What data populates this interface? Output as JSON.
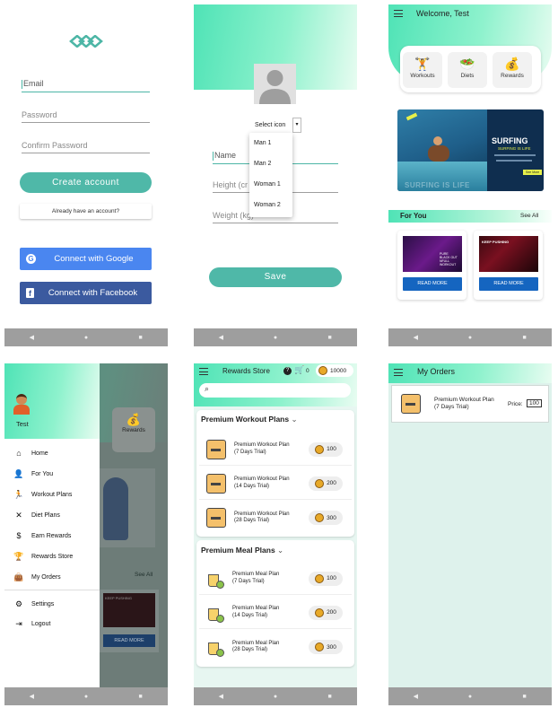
{
  "s1": {
    "email_placeholder": "Email",
    "password_placeholder": "Password",
    "confirm_placeholder": "Confirm Password",
    "create_btn": "Create account",
    "have_account_btn": "Already have an account?",
    "google_btn": "Connect with Google",
    "facebook_btn": "Connect with Facebook",
    "google_letter": "G",
    "facebook_letter": "f"
  },
  "s2": {
    "select_icon": "Select icon",
    "options": [
      "Man 1",
      "Man 2",
      "Woman 1",
      "Woman 2"
    ],
    "name_placeholder": "Name",
    "height_placeholder": "Height (cr",
    "weight_placeholder": "Weight (kg)",
    "save_btn": "Save"
  },
  "s3": {
    "welcome": "Welcome, Test",
    "categories": [
      "Workouts",
      "Diets",
      "Rewards"
    ],
    "banner_title": "SURFING",
    "banner_subtitle": "SURFING IS LIFE",
    "banner_bottom": "SURFING IS LIFE",
    "banner_cta": "See More",
    "for_you": "For You",
    "see_all": "See All",
    "card1_text": "PURE BLACK OUT NFULL WORKOUT",
    "card2_text": "KEEP PUSHING",
    "read_more": "READ MORE"
  },
  "s4": {
    "user_name": "Test",
    "bg_rewards": "Rewards",
    "bg_see_all": "See All",
    "bg_read_more": "READ MORE",
    "bg_card_text": "KEEP PUSHING",
    "menu": [
      "Home",
      "For You",
      "Workout Plans",
      "Diet Plans",
      "Earn Rewards",
      "Rewards Store",
      "My Orders"
    ],
    "settings": "Settings",
    "logout": "Logout"
  },
  "s5": {
    "title": "Rewards Store",
    "cart_count": "0",
    "balance": "10000",
    "workout_section": "Premium Workout Plans",
    "meal_section": "Premium Meal Plans",
    "workout_items": [
      {
        "name": "Premium Workout Plan",
        "trial": "(7 Days Trial)",
        "price": "100"
      },
      {
        "name": "Premium Workout Plan",
        "trial": "(14 Days Trial)",
        "price": "200"
      },
      {
        "name": "Premium Workout Plan",
        "trial": "(28 Days Trial)",
        "price": "300"
      }
    ],
    "meal_items": [
      {
        "name": "Premium Meal Plan",
        "trial": "(7 Days Trial)",
        "price": "100"
      },
      {
        "name": "Premium Meal Plan",
        "trial": "(14 Days Trial)",
        "price": "200"
      },
      {
        "name": "Premium Meal Plan",
        "trial": "(28 Days Trial)",
        "price": "300"
      }
    ]
  },
  "s6": {
    "title": "My Orders",
    "order_name": "Premium Workout Plan",
    "order_trial": "(7 Days Trial)",
    "price_label": "Price:",
    "price_value": "100"
  },
  "nav": {
    "back": "◀",
    "home": "●",
    "recent": "■"
  },
  "colors": {
    "teal": "#4fb8a8",
    "mint": "#4fe3b6",
    "google_blue": "#4a86f0",
    "facebook_blue": "#3b5a9f",
    "read_more_blue": "#1565c0"
  }
}
